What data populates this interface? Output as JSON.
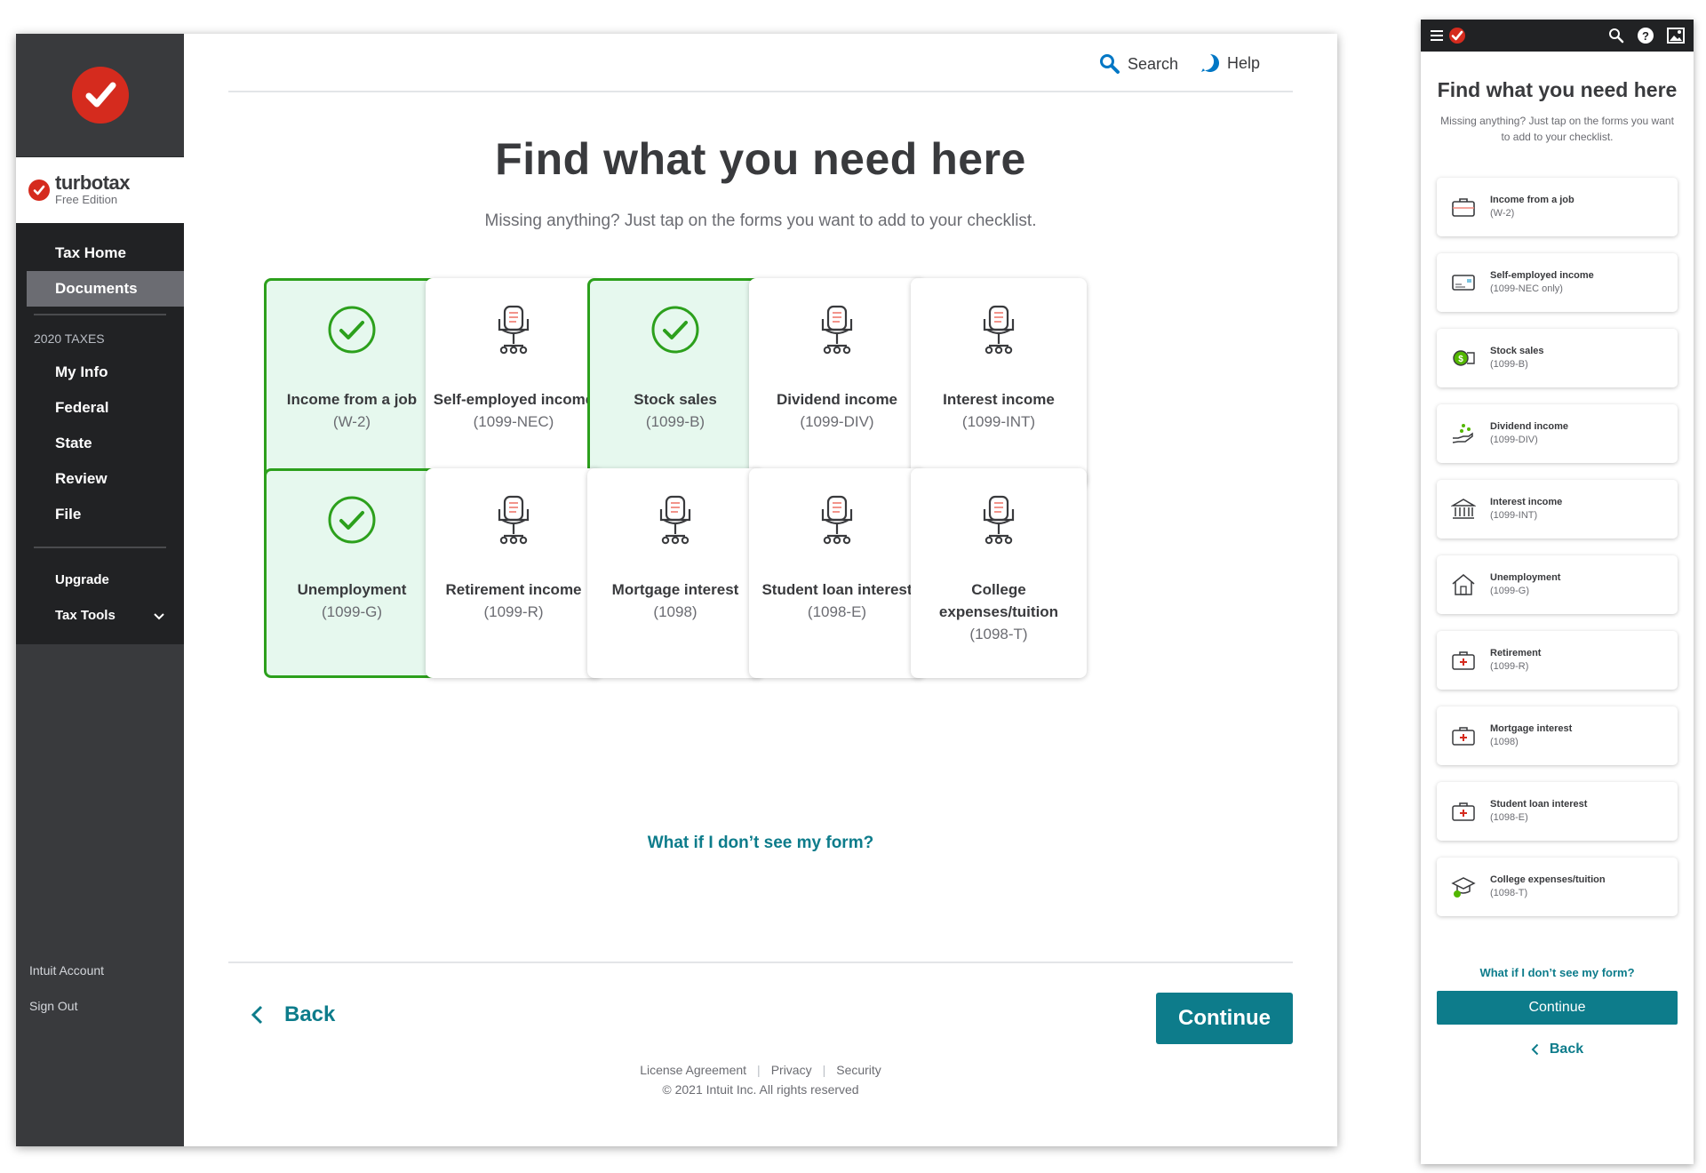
{
  "brand": {
    "name": "turbotax",
    "edition": "Free Edition",
    "accent": "#d52b1e"
  },
  "sidebar": {
    "nav_primary": [
      {
        "label": "Tax Home",
        "active": false
      },
      {
        "label": "Documents",
        "active": true
      }
    ],
    "section_label": "2020 TAXES",
    "nav_taxes": [
      {
        "label": "My Info"
      },
      {
        "label": "Federal"
      },
      {
        "label": "State"
      },
      {
        "label": "Review"
      },
      {
        "label": "File"
      }
    ],
    "upgrade": "Upgrade",
    "tax_tools": "Tax Tools",
    "account": "Intuit Account",
    "sign_out": "Sign Out"
  },
  "header": {
    "search": "Search",
    "help": "Help"
  },
  "main": {
    "title": "Find what you need here",
    "subtitle": "Missing anything? Just tap on the forms you want to add to your checklist.",
    "cards": [
      {
        "title": "Income from a job",
        "code": "(W-2)",
        "selected": true
      },
      {
        "title": "Self-employed income",
        "code": "(1099-NEC)",
        "selected": false
      },
      {
        "title": "Stock sales",
        "code": "(1099-B)",
        "selected": true
      },
      {
        "title": "Dividend income",
        "code": "(1099-DIV)",
        "selected": false
      },
      {
        "title": "Interest income",
        "code": "(1099-INT)",
        "selected": false
      },
      {
        "title": "Unemployment",
        "code": "(1099-G)",
        "selected": true
      },
      {
        "title": "Retirement income",
        "code": "(1099-R)",
        "selected": false
      },
      {
        "title": "Mortgage interest",
        "code": "(1098)",
        "selected": false
      },
      {
        "title": "Student loan interest",
        "code": "(1098-E)",
        "selected": false
      },
      {
        "title": "College expenses/tuition",
        "code": "(1098-T)",
        "selected": false
      }
    ],
    "what_if": "What if I don’t see my form?",
    "back": "Back",
    "continue": "Continue"
  },
  "footer": {
    "license": "License Agreement",
    "privacy": "Privacy",
    "security": "Security",
    "copyright": "© 2021 Intuit Inc.  All rights reserved"
  },
  "mobile": {
    "title": "Find what you need here",
    "subtitle": "Missing anything? Just tap on the forms you want to add to your checklist.",
    "items": [
      {
        "title": "Income from a job",
        "code": "(W-2)",
        "icon": "briefcase-icon"
      },
      {
        "title": "Self-employed income",
        "code": "(1099-NEC only)",
        "icon": "card-icon"
      },
      {
        "title": "Stock sales",
        "code": "(1099-B)",
        "icon": "coins-icon"
      },
      {
        "title": "Dividend income",
        "code": "(1099-DIV)",
        "icon": "hand-coins-icon"
      },
      {
        "title": "Interest income",
        "code": "(1099-INT)",
        "icon": "bank-icon"
      },
      {
        "title": "Unemployment",
        "code": "(1099-G)",
        "icon": "house-icon"
      },
      {
        "title": "Retirement",
        "code": "(1099-R)",
        "icon": "medkit-icon"
      },
      {
        "title": "Mortgage interest",
        "code": "(1098)",
        "icon": "medkit-icon"
      },
      {
        "title": "Student loan interest",
        "code": "(1098-E)",
        "icon": "medkit-icon"
      },
      {
        "title": "College expenses/tuition",
        "code": "(1098-T)",
        "icon": "graduation-cap-icon"
      }
    ],
    "what_if": "What if I don’t see my form?",
    "continue": "Continue",
    "back": "Back"
  },
  "colors": {
    "teal": "#0d7c8b",
    "selected_bg": "#e6f8ee",
    "selected_border": "#2ca01c",
    "sidebar_bg": "#393a3d"
  }
}
